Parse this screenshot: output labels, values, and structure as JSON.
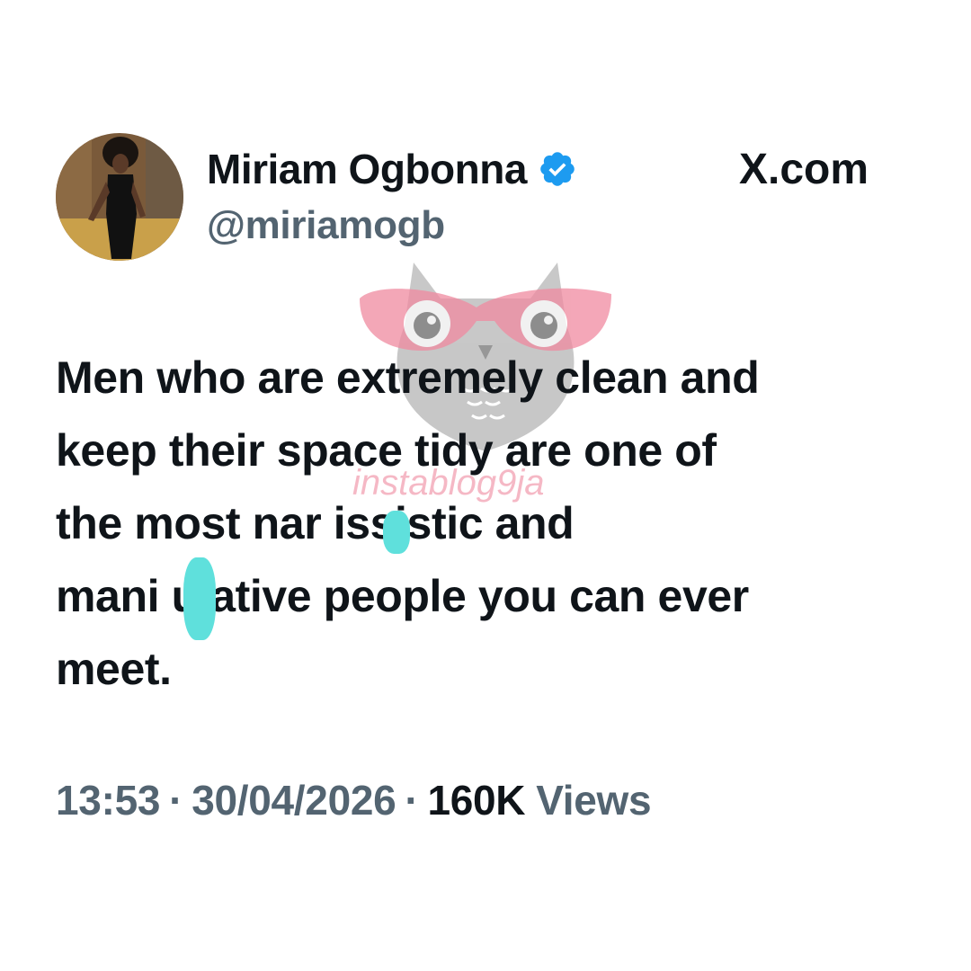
{
  "author": {
    "display_name": "Miriam Ogbonna",
    "handle": "@miriamogb",
    "verified": true
  },
  "source_label": "X.com",
  "tweet": {
    "lines": [
      "Men who are extremely clean and",
      "keep their space tidy are one of",
      "the most nar issistic and",
      "mani ulative people you can ever",
      "meet."
    ]
  },
  "meta": {
    "time": "13:53",
    "date": "30/04/2026",
    "views_count": "160K",
    "views_label": "Views",
    "separator": "·"
  },
  "watermark": {
    "text": "instablog9ja"
  },
  "colors": {
    "text_primary": "#0f1419",
    "text_secondary": "#536471",
    "verified_blue": "#1d9bf0",
    "censor_blob": "#5fe0dc",
    "watermark_pink": "#f08aa0",
    "watermark_grey": "#9a9a9a"
  }
}
